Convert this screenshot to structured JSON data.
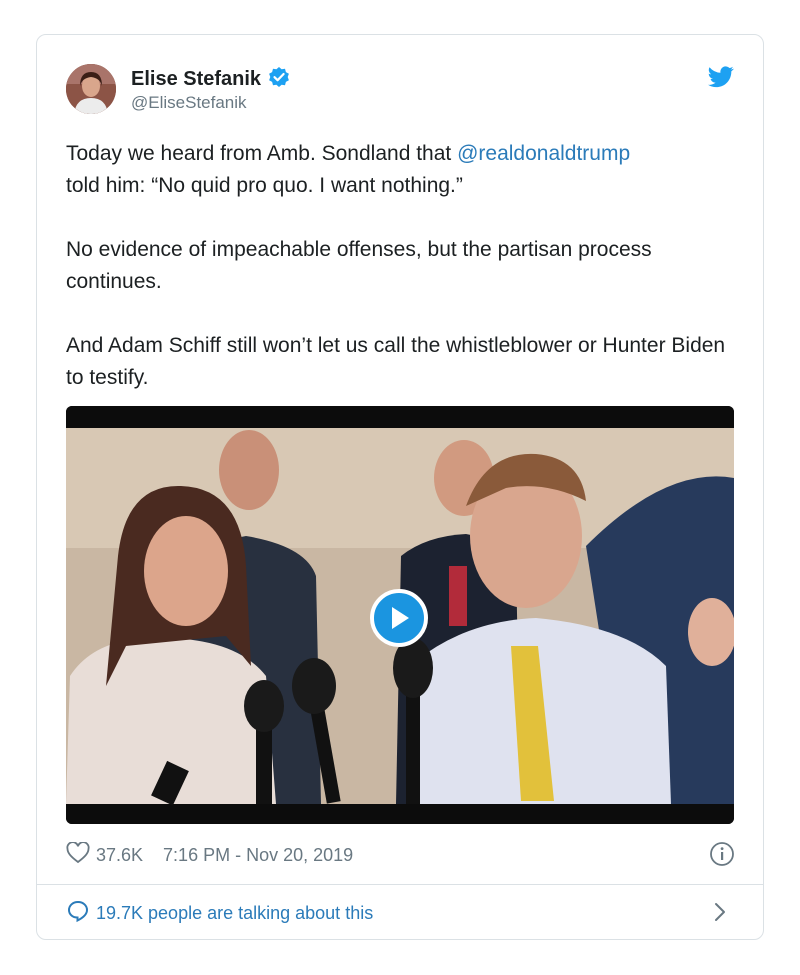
{
  "author": {
    "display_name": "Elise Stefanik",
    "handle": "@EliseStefanik",
    "verified_icon": "verified-badge-icon",
    "avatar_icon": "profile-avatar"
  },
  "brand_icon": "twitter-bird-icon",
  "tweet": {
    "p1_before": "Today we heard from Amb. Sondland that ",
    "p1_mention": "@realdonaldtrump",
    "p1_after": " told him: “No quid pro quo. I want nothing.”",
    "p2": "No evidence of impeachable offenses, but the partisan process continues.",
    "p3": "And Adam Schiff still won’t let us call the whistleblower or Hunter Biden to testify."
  },
  "media": {
    "type": "video",
    "play_icon": "play-icon"
  },
  "footer": {
    "likes": "37.6K",
    "timestamp": "7:16 PM - Nov 20, 2019",
    "talking": "19.7K people are talking about this"
  },
  "colors": {
    "link": "#2b7bb9",
    "brand": "#1da1f2",
    "muted": "#697882",
    "border": "#dbe1e5"
  }
}
